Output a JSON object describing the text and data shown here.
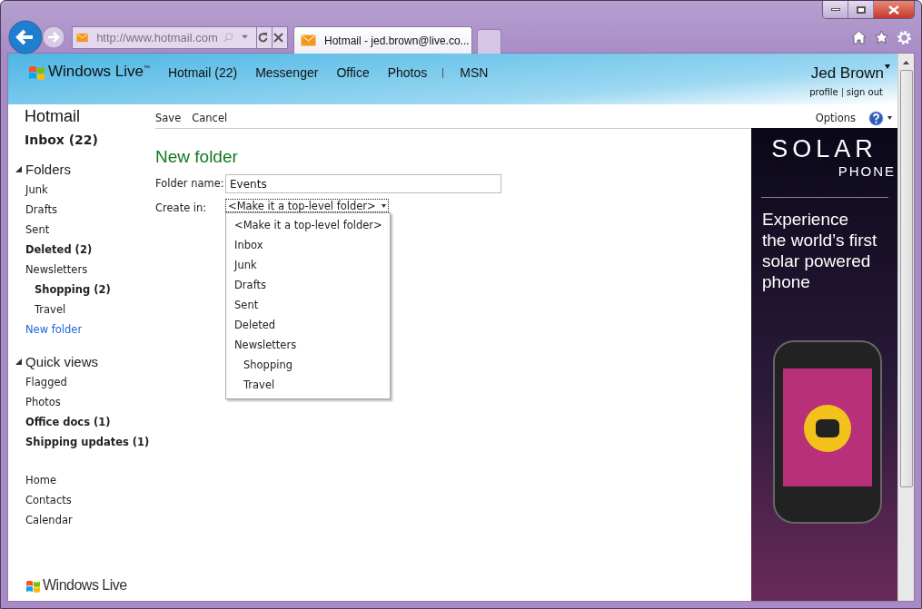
{
  "browser": {
    "address": "http://www.hotmail.com",
    "tab_title": "Hotmail - jed.brown@live.co..."
  },
  "header": {
    "brand": "Windows Live",
    "brand_mark": "™",
    "nav": [
      {
        "label": "Hotmail (22)"
      },
      {
        "label": "Messenger"
      },
      {
        "label": "Office"
      },
      {
        "label": "Photos"
      },
      {
        "label": "MSN",
        "separated": true
      }
    ],
    "user": "Jed Brown",
    "links": [
      "profile",
      "sign out"
    ]
  },
  "sidebar": {
    "title": "Hotmail",
    "inbox": "Inbox (22)",
    "sections": [
      {
        "title": "Folders",
        "expanded": true,
        "items": [
          {
            "label": "Junk",
            "unread": false
          },
          {
            "label": "Drafts",
            "unread": false
          },
          {
            "label": "Sent",
            "unread": false
          },
          {
            "label": "Deleted (2)",
            "unread": true
          },
          {
            "label": "Newsletters",
            "unread": false,
            "children": [
              {
                "label": "Shopping (2)",
                "unread": true
              },
              {
                "label": "Travel",
                "unread": false
              }
            ]
          }
        ],
        "link": "New folder"
      },
      {
        "title": "Quick views",
        "expanded": true,
        "items": [
          {
            "label": "Flagged",
            "unread": false
          },
          {
            "label": "Photos",
            "unread": false
          },
          {
            "label": "Office docs (1)",
            "unread": true
          },
          {
            "label": "Shipping updates (1)",
            "unread": true
          }
        ]
      }
    ],
    "links": [
      "Home",
      "Contacts",
      "Calendar"
    ],
    "footer_brand": "Windows Live"
  },
  "toolbar": {
    "actions": [
      "Save",
      "Cancel"
    ],
    "options": "Options"
  },
  "form": {
    "heading": "New folder",
    "name_label": "Folder name:",
    "name_value": "Events",
    "create_label": "Create in:",
    "create_value": "<Make it a top-level folder>",
    "dropdown": [
      {
        "label": "<Make it a top-level folder>"
      },
      {
        "label": "Inbox"
      },
      {
        "label": "Junk"
      },
      {
        "label": "Drafts"
      },
      {
        "label": "Sent"
      },
      {
        "label": "Deleted"
      },
      {
        "label": "Newsletters",
        "children": [
          {
            "label": "Shopping"
          },
          {
            "label": "Travel"
          }
        ]
      }
    ]
  },
  "ad": {
    "logo": "SOLAR",
    "logo_sub": "PHONE",
    "tagline": [
      "Experience",
      "the world’s first",
      "solar powered",
      "phone"
    ]
  }
}
